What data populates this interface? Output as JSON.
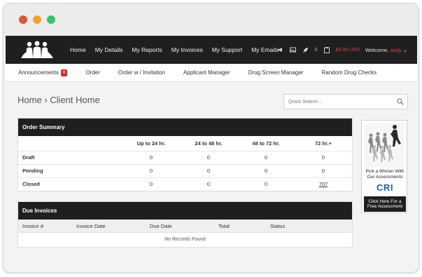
{
  "nav": {
    "links": [
      "Home",
      "My Details",
      "My Reports",
      "My Invoices",
      "My Support",
      "My Emails"
    ],
    "notification_count": "0",
    "balance": "$0.00 USD",
    "welcome_prefix": "Welcome,",
    "welcome_user": "andy",
    "icons": [
      "megaphone-icon",
      "picture-icon",
      "rocket-icon",
      "clipboard-icon",
      "chevron-down-icon"
    ]
  },
  "subnav": {
    "announcements_label": "Announcements",
    "announcements_badge": "6",
    "items": [
      "Order",
      "Order w / Invitation",
      "Applicant Manager",
      "Drug Screen Manager",
      "Random Drug Checks"
    ]
  },
  "breadcrumb": {
    "root": "Home",
    "separator": "›",
    "current": "Client Home"
  },
  "search": {
    "placeholder": "Quick Search..."
  },
  "order_summary": {
    "title": "Order Summary",
    "columns": [
      "Up to 24 hr.",
      "24 to 48 hr.",
      "48 to 72 hr.",
      "72 hr.+"
    ],
    "rows": [
      {
        "label": "Draft",
        "values": [
          "0",
          "0",
          "0",
          "0"
        ]
      },
      {
        "label": "Pending",
        "values": [
          "0",
          "0",
          "0",
          "0"
        ]
      },
      {
        "label": "Closed",
        "values": [
          "0",
          "0",
          "0",
          "707"
        ]
      }
    ]
  },
  "due_invoices": {
    "title": "Due Invoices",
    "columns": [
      "Invoice #",
      "Invoice Date",
      "Due Date",
      "Total",
      "Status"
    ],
    "empty_text": "No Records Found"
  },
  "ad": {
    "tagline_1": "Pick a Winner With",
    "tagline_2": "Our Assessments",
    "brand": "CRI",
    "button_line_1": "Click Here For a",
    "button_line_2": "Free Assessment"
  },
  "colors": {
    "navbar": "#1f1f1f",
    "accent_red": "#e04141",
    "badge": "#d9292a",
    "brand_blue": "#1c5fa8"
  }
}
